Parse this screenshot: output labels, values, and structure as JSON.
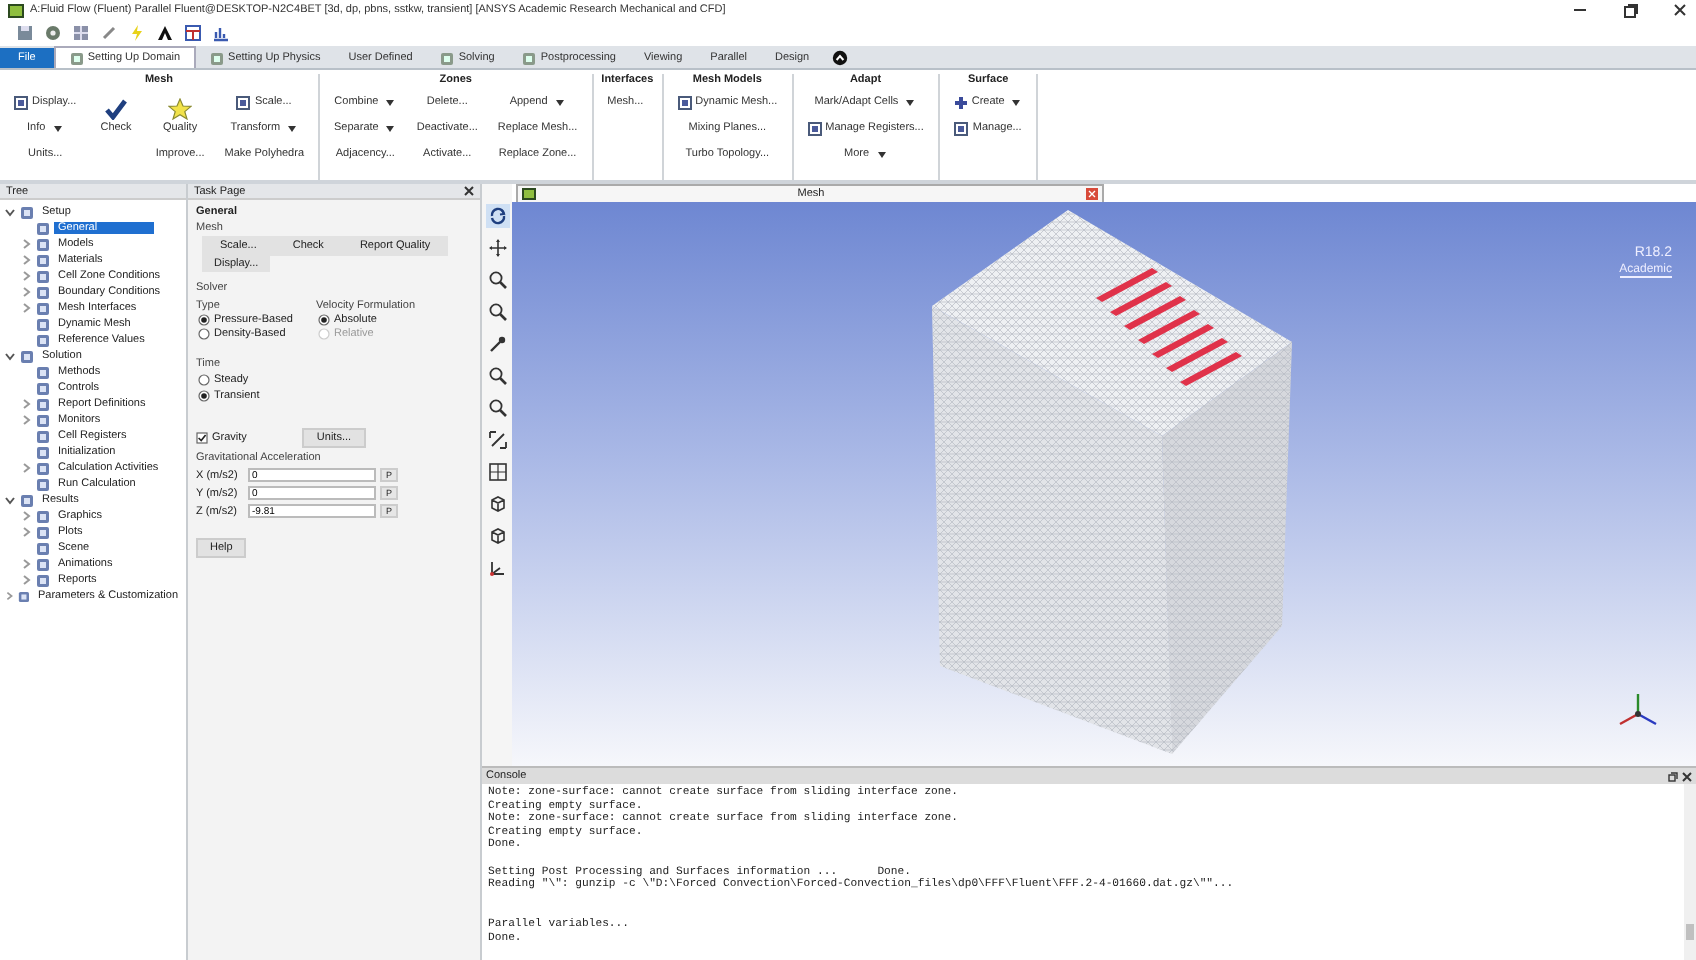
{
  "window": {
    "title": "A:Fluid Flow (Fluent) Parallel Fluent@DESKTOP-N2C4BET  [3d, dp, pbns, sstkw, transient] [ANSYS Academic Research Mechanical and CFD]"
  },
  "quick_access": [
    {
      "kind": "disk"
    },
    {
      "kind": "gear"
    },
    {
      "kind": "grid"
    },
    {
      "kind": "pen"
    },
    {
      "kind": "bolt"
    },
    {
      "kind": "arch"
    },
    {
      "kind": "table"
    },
    {
      "kind": "chart"
    }
  ],
  "tabs": [
    {
      "label": "File",
      "kind": "file",
      "selected": false
    },
    {
      "label": "Setting Up Domain",
      "kind": "icon",
      "selected": true
    },
    {
      "label": "Setting Up Physics",
      "kind": "icon",
      "selected": false
    },
    {
      "label": "User Defined",
      "kind": "plain",
      "selected": false
    },
    {
      "label": "Solving",
      "kind": "icon",
      "selected": false
    },
    {
      "label": "Postprocessing",
      "kind": "icon",
      "selected": false
    },
    {
      "label": "Viewing",
      "kind": "plain",
      "selected": false
    },
    {
      "label": "Parallel",
      "kind": "plain",
      "selected": false
    },
    {
      "label": "Design",
      "kind": "plain",
      "selected": false
    }
  ],
  "ribbon": [
    {
      "title": "Mesh",
      "columns": [
        [
          {
            "label": "Display...",
            "kind": "small",
            "dropdown": false
          },
          {
            "label": "Info",
            "kind": "plain",
            "dropdown": true
          },
          {
            "label": "Units...",
            "kind": "plain",
            "dropdown": false
          }
        ],
        [
          {
            "label": "Check",
            "kind": "check",
            "dropdown": false
          }
        ],
        [
          {
            "label": "Quality",
            "kind": "star",
            "dropdown": false
          },
          {
            "label": "Improve...",
            "kind": "plain",
            "dropdown": false
          }
        ],
        [
          {
            "label": "Scale...",
            "kind": "small",
            "dropdown": false
          },
          {
            "label": "Transform",
            "kind": "plain",
            "dropdown": true
          },
          {
            "label": "Make Polyhedra",
            "kind": "plain",
            "dropdown": false
          }
        ]
      ]
    },
    {
      "title": "Zones",
      "columns": [
        [
          {
            "label": "Combine",
            "kind": "plain",
            "dropdown": true
          },
          {
            "label": "Separate",
            "kind": "plain",
            "dropdown": true
          },
          {
            "label": "Adjacency...",
            "kind": "plain",
            "dropdown": false
          }
        ],
        [
          {
            "label": "Delete...",
            "kind": "plain",
            "dropdown": false
          },
          {
            "label": "Deactivate...",
            "kind": "plain",
            "dropdown": false
          },
          {
            "label": "Activate...",
            "kind": "plain",
            "dropdown": false
          }
        ],
        [
          {
            "label": "Append",
            "kind": "plain",
            "dropdown": true
          },
          {
            "label": "Replace Mesh...",
            "kind": "plain",
            "dropdown": false
          },
          {
            "label": "Replace Zone...",
            "kind": "plain",
            "dropdown": false
          }
        ]
      ]
    },
    {
      "title": "Interfaces",
      "columns": [
        [
          {
            "label": "Mesh...",
            "kind": "plain",
            "dropdown": false
          }
        ]
      ]
    },
    {
      "title": "Mesh Models",
      "columns": [
        [
          {
            "label": "Dynamic Mesh...",
            "kind": "small",
            "dropdown": false
          },
          {
            "label": "Mixing Planes...",
            "kind": "plain",
            "dropdown": false
          },
          {
            "label": "Turbo Topology...",
            "kind": "plain",
            "dropdown": false
          }
        ]
      ]
    },
    {
      "title": "Adapt",
      "columns": [
        [
          {
            "label": "Mark/Adapt Cells",
            "kind": "plain",
            "dropdown": true
          },
          {
            "label": "Manage Registers...",
            "kind": "small",
            "dropdown": false
          },
          {
            "label": "More",
            "kind": "plain",
            "dropdown": true
          }
        ]
      ]
    },
    {
      "title": "Surface",
      "columns": [
        [
          {
            "label": "Create",
            "kind": "add",
            "dropdown": true
          },
          {
            "label": "Manage...",
            "kind": "small",
            "dropdown": false
          }
        ]
      ]
    }
  ],
  "tree": {
    "title": "Tree",
    "items": [
      {
        "label": "Setup",
        "expanded": true,
        "selected": false,
        "children": [
          {
            "label": "General",
            "selected": true
          },
          {
            "label": "Models",
            "expanded": false,
            "selected": false
          },
          {
            "label": "Materials",
            "expanded": false,
            "selected": false
          },
          {
            "label": "Cell Zone Conditions",
            "expanded": false,
            "selected": false
          },
          {
            "label": "Boundary Conditions",
            "expanded": false,
            "selected": false
          },
          {
            "label": "Mesh Interfaces",
            "expanded": false,
            "selected": false
          },
          {
            "label": "Dynamic Mesh",
            "selected": false
          },
          {
            "label": "Reference Values",
            "selected": false
          }
        ]
      },
      {
        "label": "Solution",
        "expanded": true,
        "selected": false,
        "children": [
          {
            "label": "Methods",
            "selected": false
          },
          {
            "label": "Controls",
            "selected": false
          },
          {
            "label": "Report Definitions",
            "expanded": false,
            "selected": false
          },
          {
            "label": "Monitors",
            "expanded": false,
            "selected": false
          },
          {
            "label": "Cell Registers",
            "selected": false
          },
          {
            "label": "Initialization",
            "selected": false
          },
          {
            "label": "Calculation Activities",
            "expanded": false,
            "selected": false
          },
          {
            "label": "Run Calculation",
            "selected": false
          }
        ]
      },
      {
        "label": "Results",
        "expanded": true,
        "selected": false,
        "children": [
          {
            "label": "Graphics",
            "expanded": false,
            "selected": false
          },
          {
            "label": "Plots",
            "expanded": false,
            "selected": false
          },
          {
            "label": "Scene",
            "selected": false
          },
          {
            "label": "Animations",
            "expanded": false,
            "selected": false
          },
          {
            "label": "Reports",
            "expanded": false,
            "selected": false
          }
        ]
      },
      {
        "label": "Parameters & Customization",
        "expanded": false,
        "selected": false
      }
    ]
  },
  "task_page": {
    "title": "Task Page",
    "heading": "General",
    "mesh_label": "Mesh",
    "mesh_buttons": [
      "Scale...",
      "Check",
      "Report Quality"
    ],
    "display_button": "Display...",
    "solver_label": "Solver",
    "type_label": "Type",
    "type_options": [
      {
        "label": "Pressure-Based",
        "selected": true
      },
      {
        "label": "Density-Based",
        "selected": false
      }
    ],
    "velocity_label": "Velocity Formulation",
    "velocity_options": [
      {
        "label": "Absolute",
        "selected": true,
        "disabled": false
      },
      {
        "label": "Relative",
        "selected": false,
        "disabled": true
      }
    ],
    "time_label": "Time",
    "time_options": [
      {
        "label": "Steady",
        "selected": false
      },
      {
        "label": "Transient",
        "selected": true
      }
    ],
    "gravity": {
      "label": "Gravity",
      "checked": true
    },
    "units_button": "Units...",
    "acceleration_label": "Gravitational Acceleration",
    "acceleration_fields": [
      {
        "label": "X (m/s2)",
        "value": "0",
        "unit": "P"
      },
      {
        "label": "Y (m/s2)",
        "value": "0",
        "unit": "P"
      },
      {
        "label": "Z (m/s2)",
        "value": "-9.81",
        "unit": "P"
      }
    ],
    "help_button": "Help"
  },
  "view_tools": [
    {
      "kind": "rotate",
      "selected": true
    },
    {
      "kind": "pan",
      "selected": false
    },
    {
      "kind": "zoom",
      "selected": false
    },
    {
      "kind": "zoom",
      "selected": false
    },
    {
      "kind": "probe",
      "selected": false
    },
    {
      "kind": "zoom",
      "selected": false
    },
    {
      "kind": "zoom",
      "selected": false
    },
    {
      "kind": "fit",
      "selected": false
    },
    {
      "kind": "grid",
      "selected": false
    },
    {
      "kind": "cube",
      "selected": false
    },
    {
      "kind": "cube",
      "selected": false
    },
    {
      "kind": "axes",
      "selected": false
    }
  ],
  "viewport": {
    "title": "Mesh",
    "version": "R18.2",
    "edition": "Academic"
  },
  "console": {
    "title": "Console",
    "blocks": [
      {
        "lines": [
          "Note: zone-surface: cannot create surface from sliding interface zone.",
          "Creating empty surface.",
          "Note: zone-surface: cannot create surface from sliding interface zone.",
          "Creating empty surface.",
          "Done."
        ]
      },
      {
        "lines": [
          "Setting Post Processing and Surfaces information ...      Done.",
          "Reading \"\\\": gunzip -c \\\"D:\\Forced Convection\\Forced-Convection_files\\dp0\\FFF\\Fluent\\FFF.2-4-01660.dat.gz\\\"\"..."
        ]
      },
      {
        "lines": [
          "Parallel variables...",
          "Done."
        ]
      }
    ]
  }
}
